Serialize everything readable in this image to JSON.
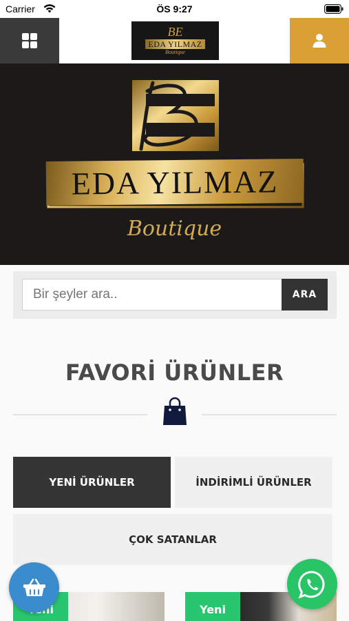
{
  "status_bar": {
    "carrier": "Carrier",
    "time": "ÖS 9:27"
  },
  "header": {
    "logo": {
      "monogram": "BE",
      "name": "EDA YILMAZ",
      "tagline": "Boutique"
    },
    "menu_icon": "grid-icon",
    "user_icon": "user-icon"
  },
  "banner": {
    "monogram": "BE",
    "name": "EDA YILMAZ",
    "tagline": "Boutique"
  },
  "search": {
    "placeholder": "Bir şeyler ara..",
    "button_label": "ARA"
  },
  "section": {
    "title": "FAVORİ ÜRÜNLER",
    "icon": "shopping-bag-icon"
  },
  "tabs": [
    {
      "label": "YENİ ÜRÜNLER",
      "active": true
    },
    {
      "label": "İNDİRİMLİ ÜRÜNLER",
      "active": false
    },
    {
      "label": "ÇOK SATANLAR",
      "active": false
    }
  ],
  "products": [
    {
      "badge": "Yeni"
    },
    {
      "badge": "Yeni"
    }
  ],
  "floating": {
    "basket_icon": "basket-icon",
    "whatsapp_icon": "whatsapp-icon"
  },
  "colors": {
    "dark": "#353535",
    "accent_gold": "#dba035",
    "badge_green": "#28c76f",
    "basket_blue": "#3a8ccc",
    "whatsapp_green": "#29c466",
    "bag_navy": "#0f1a3c"
  }
}
